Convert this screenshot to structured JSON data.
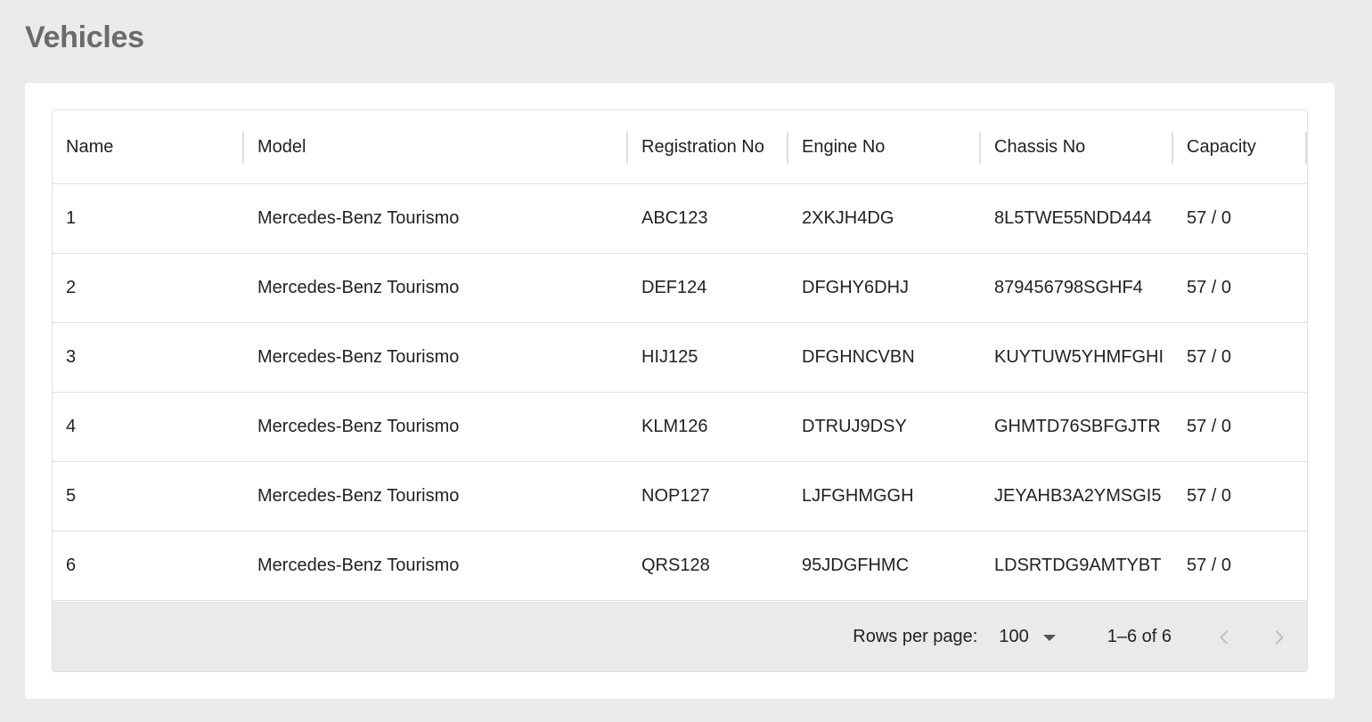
{
  "page": {
    "title": "Vehicles"
  },
  "table": {
    "columns": [
      {
        "key": "name",
        "label": "Name"
      },
      {
        "key": "model",
        "label": "Model"
      },
      {
        "key": "registration",
        "label": "Registration No"
      },
      {
        "key": "engine",
        "label": "Engine No"
      },
      {
        "key": "chassis",
        "label": "Chassis No"
      },
      {
        "key": "capacity",
        "label": "Capacity"
      }
    ],
    "rows": [
      {
        "name": "1",
        "model": "Mercedes-Benz Tourismo",
        "registration": "ABC123",
        "engine": "2XKJH4DG",
        "chassis": "8L5TWE55NDD444",
        "capacity": "57 / 0"
      },
      {
        "name": "2",
        "model": "Mercedes-Benz Tourismo",
        "registration": "DEF124",
        "engine": "DFGHY6DHJ",
        "chassis": "879456798SGHF4",
        "capacity": "57 / 0"
      },
      {
        "name": "3",
        "model": "Mercedes-Benz Tourismo",
        "registration": "HIJ125",
        "engine": "DFGHNCVBN",
        "chassis": "KUYTUW5YHMFGHI",
        "capacity": "57 / 0"
      },
      {
        "name": "4",
        "model": "Mercedes-Benz Tourismo",
        "registration": "KLM126",
        "engine": "DTRUJ9DSY",
        "chassis": "GHMTD76SBFGJTR",
        "capacity": "57 / 0"
      },
      {
        "name": "5",
        "model": "Mercedes-Benz Tourismo",
        "registration": "NOP127",
        "engine": "LJFGHMGGH",
        "chassis": "JEYAHB3A2YMSGI5",
        "capacity": "57 / 0"
      },
      {
        "name": "6",
        "model": "Mercedes-Benz Tourismo",
        "registration": "QRS128",
        "engine": "95JDGFHMC",
        "chassis": "LDSRTDG9AMTYBT",
        "capacity": "57 / 0"
      }
    ]
  },
  "pagination": {
    "rows_per_page_label": "Rows per page:",
    "rows_per_page_value": "100",
    "range_text": "1–6 of 6",
    "prev_icon": "chevron-left-icon",
    "next_icon": "chevron-right-icon"
  },
  "colors": {
    "page_background": "#ebebeb",
    "card_background": "#ffffff",
    "footer_background": "#eaeaea",
    "border": "#e0e0e0",
    "title": "#6b6b6b"
  }
}
